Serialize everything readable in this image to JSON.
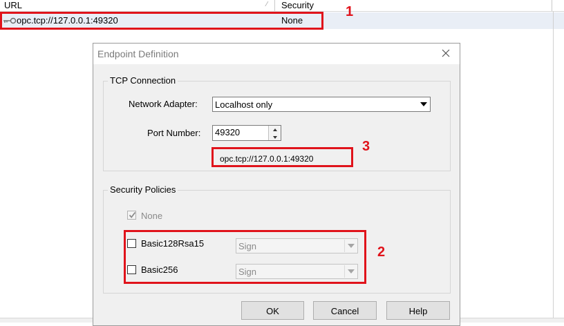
{
  "list": {
    "columns": [
      "URL",
      "Security"
    ],
    "rows": [
      {
        "url": "opc.tcp://127.0.0.1:49320",
        "security": "None"
      }
    ]
  },
  "dialog": {
    "title": "Endpoint Definition",
    "tcp_group": {
      "legend": "TCP Connection",
      "network_adapter_label": "Network Adapter:",
      "network_adapter_value": "Localhost only",
      "port_label": "Port Number:",
      "port_value": "49320",
      "endpoint_url": "opc.tcp://127.0.0.1:49320"
    },
    "security_group": {
      "legend": "Security Policies",
      "policies": [
        {
          "name": "None",
          "checked": true,
          "disabled": true
        },
        {
          "name": "Basic128Rsa15",
          "checked": false,
          "mode": "Sign"
        },
        {
          "name": "Basic256",
          "checked": false,
          "mode": "Sign"
        }
      ]
    },
    "buttons": {
      "ok": "OK",
      "cancel": "Cancel",
      "help": "Help"
    }
  },
  "annotations": [
    "1",
    "2",
    "3"
  ],
  "colors": {
    "annotation": "#e0131b",
    "row_highlight": "#e9eef6",
    "dialog_bg": "#f0f0f0"
  }
}
